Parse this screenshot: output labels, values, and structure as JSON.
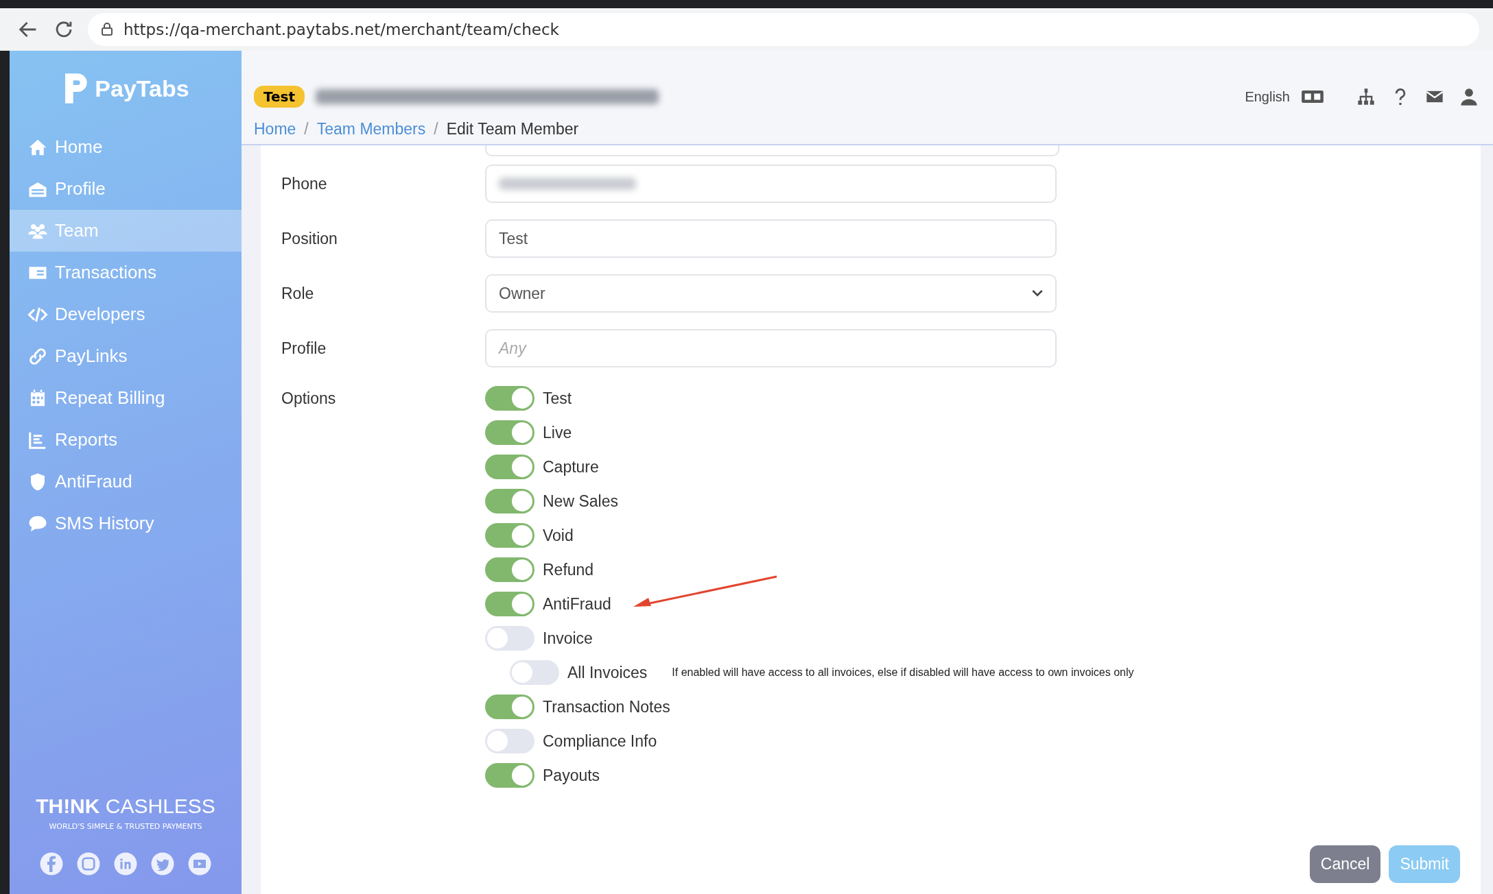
{
  "browser": {
    "url": "https://qa-merchant.paytabs.net/merchant/team/check"
  },
  "sidebar": {
    "logo": "PayTabs",
    "items": [
      {
        "label": "Home",
        "selected": false
      },
      {
        "label": "Profile",
        "selected": false
      },
      {
        "label": "Team",
        "selected": true
      },
      {
        "label": "Transactions",
        "selected": false
      },
      {
        "label": "Developers",
        "selected": false
      },
      {
        "label": "PayLinks",
        "selected": false
      },
      {
        "label": "Repeat Billing",
        "selected": false
      },
      {
        "label": "Reports",
        "selected": false
      },
      {
        "label": "AntiFraud",
        "selected": false
      },
      {
        "label": "SMS History",
        "selected": false
      }
    ],
    "slogan": {
      "bold": "TH!NK",
      "light": "CASHLESS",
      "tagline": "WORLD'S SIMPLE & TRUSTED PAYMENTS"
    }
  },
  "header": {
    "badge": "Test",
    "language": "English",
    "breadcrumbs": [
      {
        "label": "Home",
        "link": true
      },
      {
        "label": "Team Members",
        "link": true
      },
      {
        "label": "Edit Team Member",
        "link": false
      }
    ],
    "separators": [
      "/",
      "/"
    ]
  },
  "form": {
    "fields": [
      {
        "label": "Phone",
        "kind": "text"
      },
      {
        "label": "Position",
        "kind": "text",
        "value": "Test"
      },
      {
        "label": "Role",
        "kind": "select",
        "value": "Owner"
      },
      {
        "label": "Profile",
        "kind": "text",
        "placeholder": "Any"
      }
    ],
    "options_label": "Options",
    "options": [
      {
        "label": "Test",
        "on": true
      },
      {
        "label": "Live",
        "on": true
      },
      {
        "label": "Capture",
        "on": true
      },
      {
        "label": "New Sales",
        "on": true
      },
      {
        "label": "Void",
        "on": true
      },
      {
        "label": "Refund",
        "on": true
      },
      {
        "label": "AntiFraud",
        "on": true
      },
      {
        "label": "Invoice",
        "on": false,
        "children": [
          {
            "label": "All Invoices",
            "on": false,
            "hint": "If enabled will have access to all invoices, else if disabled will have access to own invoices only"
          }
        ]
      },
      {
        "label": "Transaction Notes",
        "on": true
      },
      {
        "label": "Compliance Info",
        "on": false
      },
      {
        "label": "Payouts",
        "on": true
      }
    ],
    "buttons": [
      {
        "label": "Cancel",
        "kind": "cancel"
      },
      {
        "label": "Submit",
        "kind": "submit"
      }
    ]
  }
}
